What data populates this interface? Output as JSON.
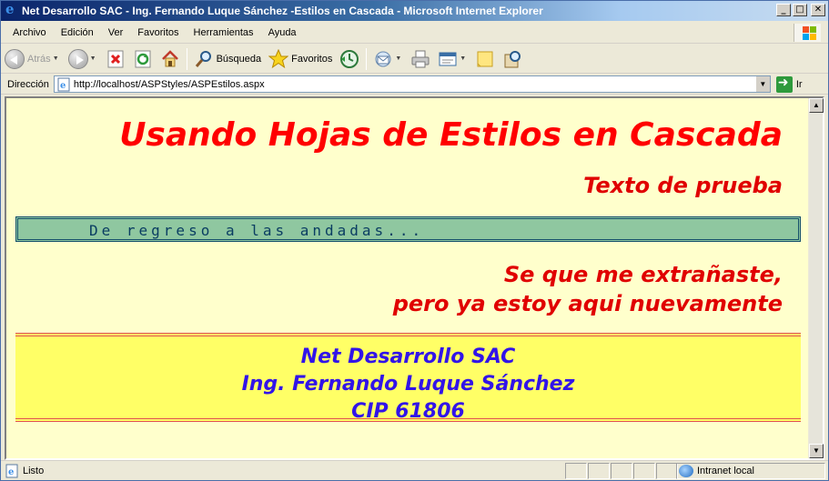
{
  "window": {
    "title": "Net Desarrollo SAC - Ing. Fernando Luque Sánchez -Estilos en Cascada - Microsoft Internet Explorer",
    "controls": {
      "minimize": "_",
      "maximize": "□",
      "close": "✕"
    }
  },
  "menu": {
    "items": [
      "Archivo",
      "Edición",
      "Ver",
      "Favoritos",
      "Herramientas",
      "Ayuda"
    ]
  },
  "toolbar": {
    "back_label": "Atrás",
    "search_label": "Búsqueda",
    "favorites_label": "Favoritos"
  },
  "address": {
    "label": "Dirección",
    "url": "http://localhost/ASPStyles/ASPEstilos.aspx",
    "go_label": "Ir"
  },
  "page": {
    "heading": "Usando Hojas de Estilos en Cascada",
    "subheading": "Texto de prueba",
    "green_text": "De regreso a las andadas...",
    "paragraph_line1": "Se que me extrañaste,",
    "paragraph_line2": "pero ya estoy aqui nuevamente",
    "footer_line1": "Net Desarrollo SAC",
    "footer_line2": "Ing. Fernando Luque Sánchez",
    "footer_line3": "CIP 61806"
  },
  "status": {
    "text": "Listo",
    "zone": "Intranet local"
  },
  "colors": {
    "page_bg": "#ffffcc",
    "heading_red": "#ff0000",
    "green_box": "#8fc7a0",
    "footer_bg": "#ffff66",
    "footer_text": "#3214e8"
  }
}
